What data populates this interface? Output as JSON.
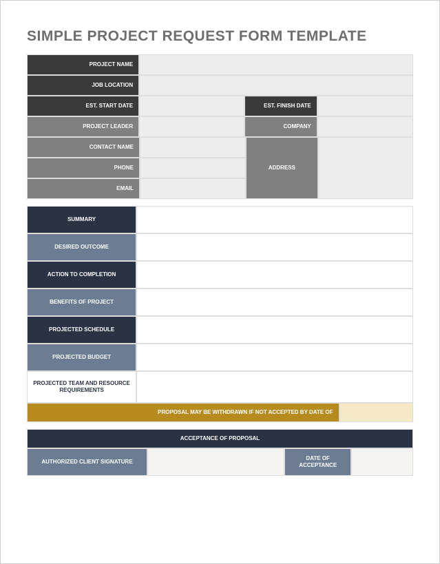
{
  "title": "SIMPLE PROJECT REQUEST FORM TEMPLATE",
  "top": {
    "project_name": "PROJECT NAME",
    "project_name_val": "",
    "job_location": "JOB LOCATION",
    "job_location_val": "",
    "est_start": "EST. START DATE",
    "est_start_val": "",
    "est_finish": "EST. FINISH DATE",
    "est_finish_val": "",
    "project_leader": "PROJECT LEADER",
    "project_leader_val": "",
    "company": "COMPANY",
    "company_val": "",
    "contact_name": "CONTACT NAME",
    "contact_name_val": "",
    "address": "ADDRESS",
    "address_val": "",
    "phone": "PHONE",
    "phone_val": "",
    "email": "EMAIL",
    "email_val": ""
  },
  "mid": {
    "summary": "SUMMARY",
    "summary_val": "",
    "outcome": "DESIRED OUTCOME",
    "outcome_val": "",
    "action": "ACTION TO COMPLETION",
    "action_val": "",
    "benefits": "BENEFITS OF PROJECT",
    "benefits_val": "",
    "schedule": "PROJECTED SCHEDULE",
    "schedule_val": "",
    "budget": "PROJECTED BUDGET",
    "budget_val": "",
    "team": "PROJECTED TEAM AND RESOURCE REQUIREMENTS",
    "team_val": ""
  },
  "gold": {
    "notice": "PROPOSAL MAY BE WITHDRAWN IF NOT ACCEPTED BY DATE OF",
    "notice_val": ""
  },
  "accept": {
    "title": "ACCEPTANCE OF PROPOSAL",
    "signature": "AUTHORIZED CLIENT SIGNATURE",
    "signature_val": "",
    "date": "DATE OF ACCEPTANCE",
    "date_val": ""
  }
}
